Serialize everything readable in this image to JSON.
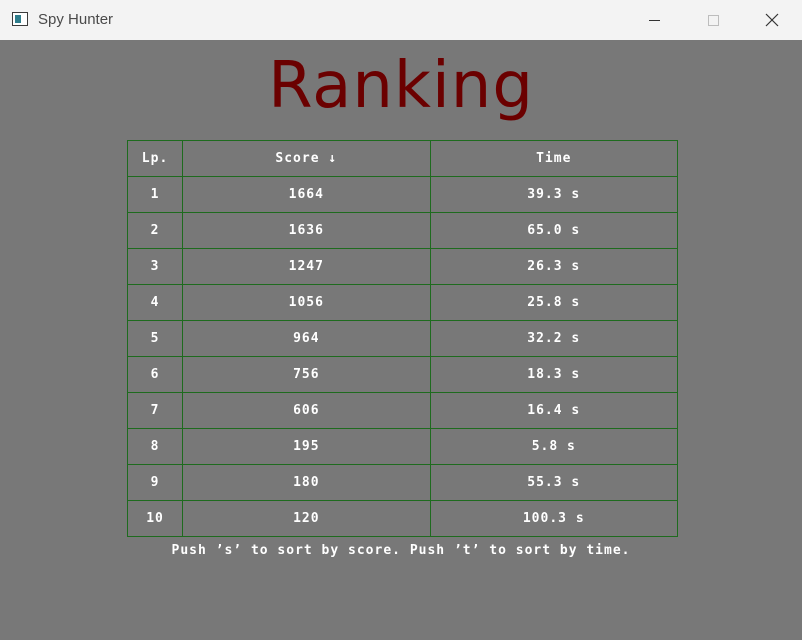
{
  "window": {
    "title": "Spy Hunter"
  },
  "screen": {
    "heading": "Ranking",
    "columns": {
      "lp": "Lp.",
      "score": "Score ↓",
      "time": "Time"
    },
    "rows": [
      {
        "lp": "1",
        "score": "1664",
        "time": "39.3 s"
      },
      {
        "lp": "2",
        "score": "1636",
        "time": "65.0 s"
      },
      {
        "lp": "3",
        "score": "1247",
        "time": "26.3 s"
      },
      {
        "lp": "4",
        "score": "1056",
        "time": "25.8 s"
      },
      {
        "lp": "5",
        "score": "964",
        "time": "32.2 s"
      },
      {
        "lp": "6",
        "score": "756",
        "time": "18.3 s"
      },
      {
        "lp": "7",
        "score": "606",
        "time": "16.4 s"
      },
      {
        "lp": "8",
        "score": "195",
        "time": "5.8 s"
      },
      {
        "lp": "9",
        "score": "180",
        "time": "55.3 s"
      },
      {
        "lp": "10",
        "score": "120",
        "time": "100.3 s"
      }
    ],
    "hint": "Push ’s’ to sort by score. Push ’t’ to sort by time."
  },
  "colors": {
    "background": "#787878",
    "heading": "#6b0000",
    "grid": "#1e6b1e",
    "text": "#ffffff"
  }
}
